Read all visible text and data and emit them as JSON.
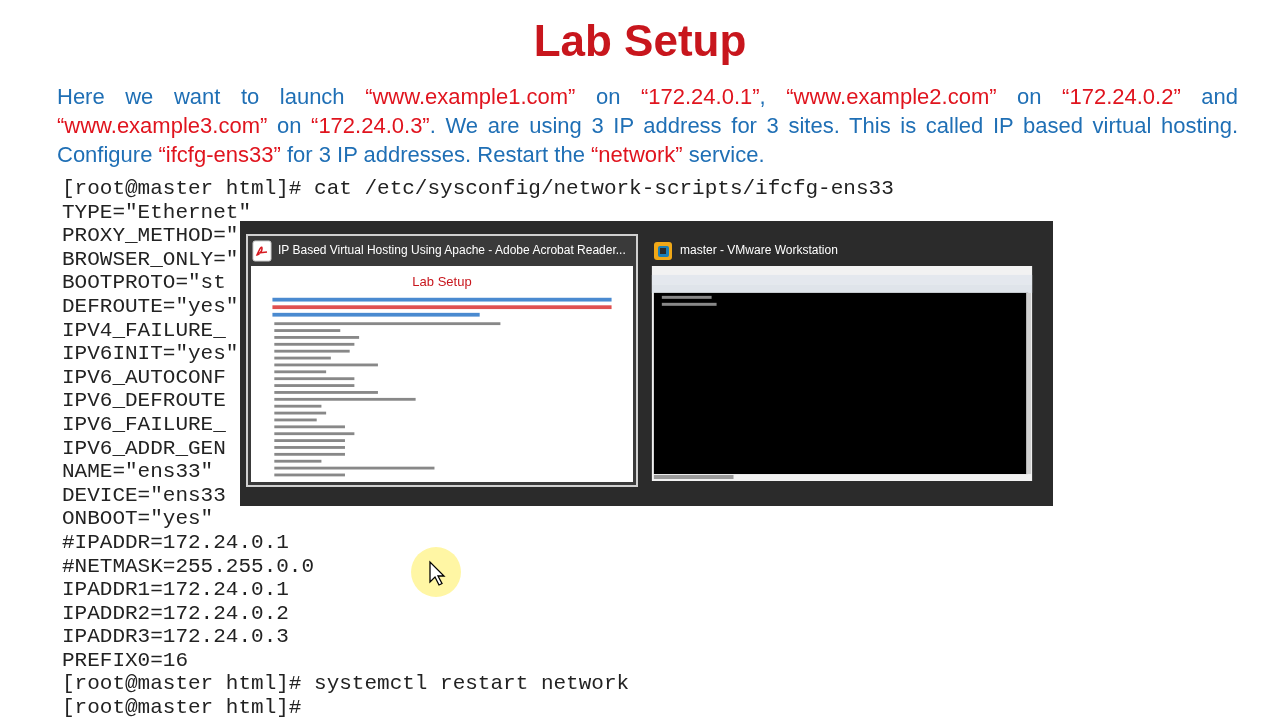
{
  "slide": {
    "title": "Lab Setup",
    "intro": [
      {
        "text": "Here we want to launch ",
        "kind": "plain"
      },
      {
        "text": "“www.example1.com”",
        "kind": "highlight"
      },
      {
        "text": " on ",
        "kind": "plain"
      },
      {
        "text": "“172.24.0.1”",
        "kind": "highlight"
      },
      {
        "text": ", ",
        "kind": "plain"
      },
      {
        "text": "“www.example2.com”",
        "kind": "highlight"
      },
      {
        "text": " on ",
        "kind": "plain"
      },
      {
        "text": "“172.24.0.2”",
        "kind": "highlight"
      },
      {
        "text": " and ",
        "kind": "plain"
      },
      {
        "text": "“www.example3.com”",
        "kind": "highlight"
      },
      {
        "text": " on ",
        "kind": "plain"
      },
      {
        "text": "“172.24.0.3”",
        "kind": "highlight"
      },
      {
        "text": ". We are using 3 IP address for 3 sites. This is called IP based virtual hosting. Configure ",
        "kind": "plain"
      },
      {
        "text": "“ifcfg-ens33”",
        "kind": "highlight"
      },
      {
        "text": " for 3 IP addresses. Restart the ",
        "kind": "plain"
      },
      {
        "text": "“network”",
        "kind": "highlight"
      },
      {
        "text": " service.",
        "kind": "plain"
      }
    ],
    "terminal": [
      "[root@master html]# cat /etc/sysconfig/network-scripts/ifcfg-ens33",
      "TYPE=\"Ethernet\"",
      "PROXY_METHOD=\"",
      "BROWSER_ONLY=\"",
      "BOOTPROTO=\"st",
      "DEFROUTE=\"yes\"",
      "IPV4_FAILURE_",
      "IPV6INIT=\"yes\"",
      "IPV6_AUTOCONF",
      "IPV6_DEFROUTE",
      "IPV6_FAILURE_",
      "IPV6_ADDR_GEN",
      "NAME=\"ens33\"",
      "DEVICE=\"ens33",
      "ONBOOT=\"yes\"",
      "#IPADDR=172.24.0.1",
      "#NETMASK=255.255.0.0",
      "IPADDR1=172.24.0.1",
      "IPADDR2=172.24.0.2",
      "IPADDR3=172.24.0.3",
      "PREFIX0=16",
      "[root@master html]# systemctl restart network",
      "[root@master html]#"
    ]
  },
  "task_switcher": {
    "windows": [
      {
        "title": "IP Based Virtual Hosting Using Apache - Adobe Acrobat Reader...",
        "kind": "document",
        "selected": true,
        "preview_title": "Lab Setup"
      },
      {
        "title": "master - VMware Workstation",
        "kind": "vm",
        "selected": false
      }
    ]
  }
}
